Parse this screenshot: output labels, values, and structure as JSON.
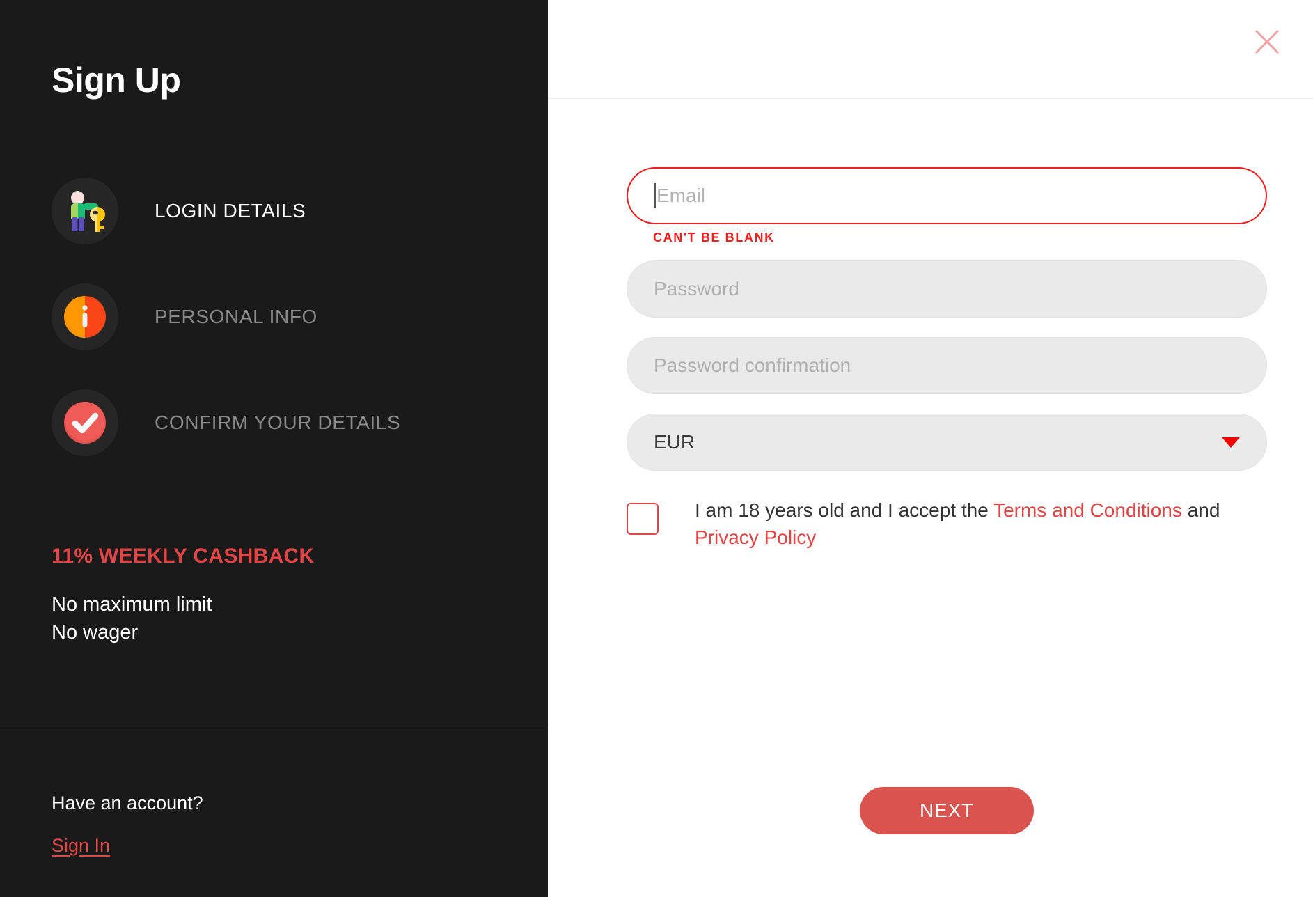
{
  "panel": {
    "title": "Sign Up",
    "steps": [
      {
        "label": "LOGIN DETAILS",
        "icon": "person-key-icon",
        "state": "active"
      },
      {
        "label": "PERSONAL INFO",
        "icon": "info-circle-icon",
        "state": "inactive"
      },
      {
        "label": "CONFIRM YOUR DETAILS",
        "icon": "check-circle-icon",
        "state": "inactive"
      }
    ],
    "promo": {
      "title": "11% WEEKLY CASHBACK",
      "line1": "No maximum limit",
      "line2": "No wager"
    },
    "footer": {
      "question": "Have an account?",
      "signin_label": "Sign In"
    }
  },
  "form": {
    "close_icon": "close-icon",
    "email": {
      "placeholder": "Email",
      "value": "",
      "error": "CAN'T BE BLANK"
    },
    "password": {
      "placeholder": "Password",
      "value": ""
    },
    "password_confirmation": {
      "placeholder": "Password confirmation",
      "value": ""
    },
    "currency": {
      "selected": "EUR",
      "caret_icon": "chevron-down-icon"
    },
    "terms": {
      "checked": false,
      "text_before": "I am 18 years old and I accept the ",
      "terms_link": "Terms and Conditions",
      "text_middle": " and ",
      "privacy_link": "Privacy Policy"
    },
    "next_label": "NEXT"
  },
  "colors": {
    "panel_bg": "#1a1a1a",
    "accent_red": "#e14545",
    "error_red": "#f41c1c",
    "button_red": "#d9534f",
    "input_bg": "#eaeaea",
    "inactive_text": "#8a8a8a"
  }
}
